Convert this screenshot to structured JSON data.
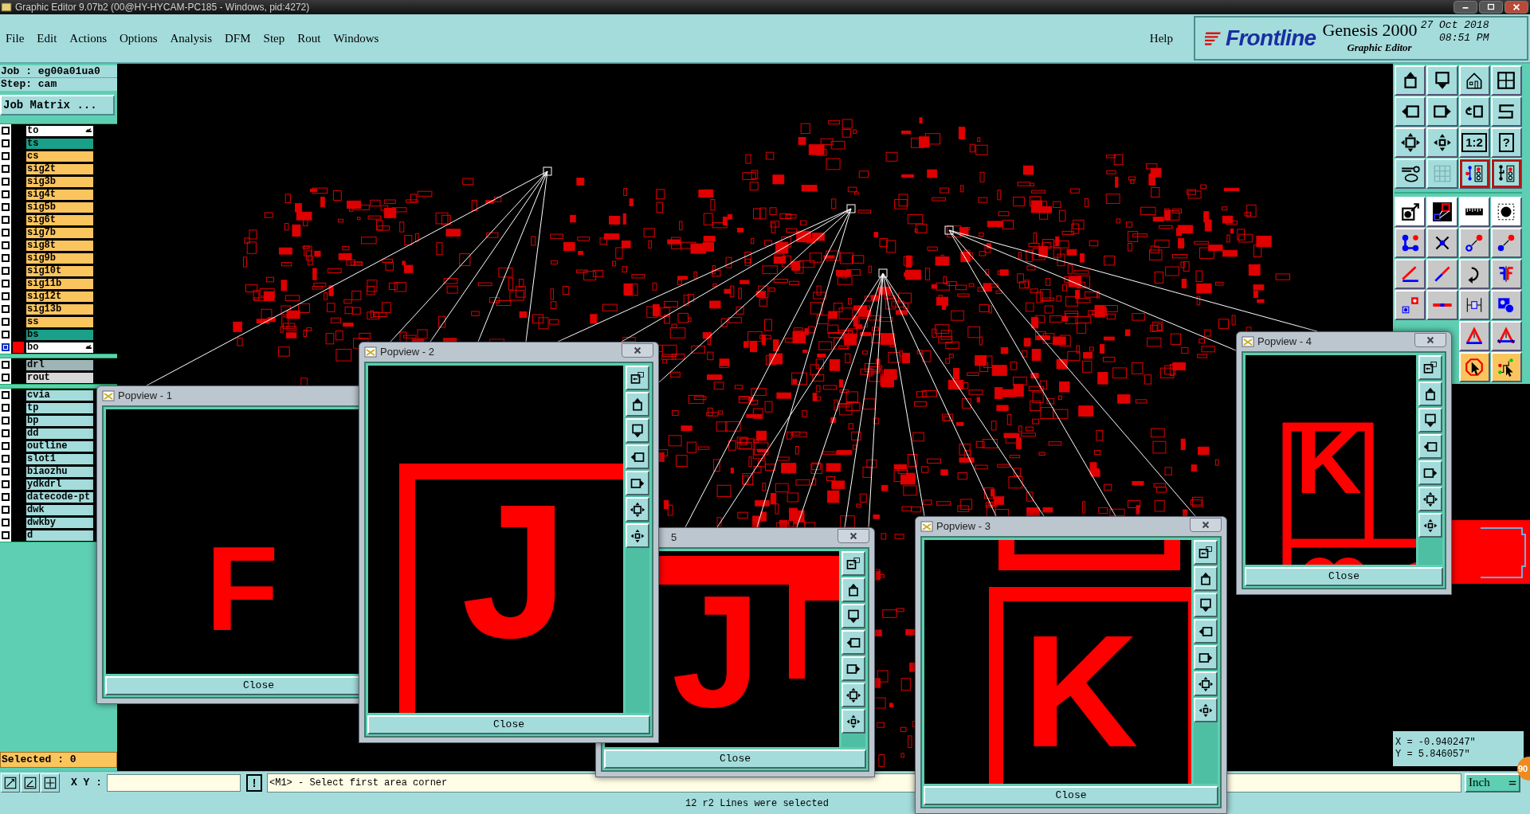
{
  "window": {
    "title": "Graphic Editor 9.07b2 (00@HY-HYCAM-PC185 - Windows, pid:4272)"
  },
  "menu": [
    {
      "label": "File"
    },
    {
      "label": "Edit"
    },
    {
      "label": "Actions"
    },
    {
      "label": "Options"
    },
    {
      "label": "Analysis"
    },
    {
      "label": "DFM"
    },
    {
      "label": "Step"
    },
    {
      "label": "Rout"
    },
    {
      "label": "Windows"
    }
  ],
  "help": "Help",
  "brand": {
    "logo": "Frontline",
    "product": "Genesis 2000",
    "subtitle": "Graphic Editor",
    "date": "27 Oct 2018",
    "time": "08:51 PM"
  },
  "job": "Job : eg00a01ua0",
  "step": "Step: cam",
  "job_matrix_button": "Job Matrix ...",
  "layer_groups": [
    {
      "layers": [
        {
          "name": "to",
          "color": "#ffffff",
          "selected": false,
          "displayed": false,
          "affected": true
        },
        {
          "name": "ts",
          "color": "#1aa088",
          "selected": false,
          "displayed": false,
          "affected": false
        },
        {
          "name": "cs",
          "color": "#fbc55e",
          "selected": false,
          "displayed": false,
          "affected": false
        },
        {
          "name": "sig2t",
          "color": "#fbc55e",
          "selected": false,
          "displayed": false,
          "affected": false
        },
        {
          "name": "sig3b",
          "color": "#fbc55e",
          "selected": false,
          "displayed": false,
          "affected": false
        },
        {
          "name": "sig4t",
          "color": "#fbc55e",
          "selected": false,
          "displayed": false,
          "affected": false
        },
        {
          "name": "sig5b",
          "color": "#fbc55e",
          "selected": false,
          "displayed": false,
          "affected": false
        },
        {
          "name": "sig6t",
          "color": "#fbc55e",
          "selected": false,
          "displayed": false,
          "affected": false
        },
        {
          "name": "sig7b",
          "color": "#fbc55e",
          "selected": false,
          "displayed": false,
          "affected": false
        },
        {
          "name": "sig8t",
          "color": "#fbc55e",
          "selected": false,
          "displayed": false,
          "affected": false
        },
        {
          "name": "sig9b",
          "color": "#fbc55e",
          "selected": false,
          "displayed": false,
          "affected": false
        },
        {
          "name": "sig10t",
          "color": "#fbc55e",
          "selected": false,
          "displayed": false,
          "affected": false
        },
        {
          "name": "sig11b",
          "color": "#fbc55e",
          "selected": false,
          "displayed": false,
          "affected": false
        },
        {
          "name": "sig12t",
          "color": "#fbc55e",
          "selected": false,
          "displayed": false,
          "affected": false
        },
        {
          "name": "sig13b",
          "color": "#fbc55e",
          "selected": false,
          "displayed": false,
          "affected": false
        },
        {
          "name": "ss",
          "color": "#fbc55e",
          "selected": false,
          "displayed": false,
          "affected": false
        },
        {
          "name": "bs",
          "color": "#1aa088",
          "selected": false,
          "displayed": false,
          "affected": false
        },
        {
          "name": "bo",
          "color": "#ffffff",
          "selected": true,
          "displayed": true,
          "affected": true
        }
      ]
    },
    {
      "layers": [
        {
          "name": "drl",
          "color": "#9fb4b7",
          "selected": false,
          "displayed": false,
          "affected": false
        },
        {
          "name": "rout",
          "color": "#d8d8d8",
          "selected": false,
          "displayed": false,
          "affected": false
        }
      ]
    },
    {
      "layers": [
        {
          "name": "cvia",
          "color": "#a4dcdc",
          "selected": false,
          "displayed": false,
          "affected": false
        },
        {
          "name": "tp",
          "color": "#a4dcdc",
          "selected": false,
          "displayed": false,
          "affected": false
        },
        {
          "name": "bp",
          "color": "#a4dcdc",
          "selected": false,
          "displayed": false,
          "affected": false
        },
        {
          "name": "dd",
          "color": "#a4dcdc",
          "selected": false,
          "displayed": false,
          "affected": false
        },
        {
          "name": "outline",
          "color": "#a4dcdc",
          "selected": false,
          "displayed": false,
          "affected": false
        },
        {
          "name": "slot1",
          "color": "#a4dcdc",
          "selected": false,
          "displayed": false,
          "affected": false
        },
        {
          "name": "biaozhu",
          "color": "#a4dcdc",
          "selected": false,
          "displayed": false,
          "affected": false
        },
        {
          "name": "ydkdrl",
          "color": "#a4dcdc",
          "selected": false,
          "displayed": false,
          "affected": false
        },
        {
          "name": "datecode-pt",
          "color": "#a4dcdc",
          "selected": false,
          "displayed": false,
          "affected": false
        },
        {
          "name": "dwk",
          "color": "#a4dcdc",
          "selected": false,
          "displayed": false,
          "affected": false
        },
        {
          "name": "dwkby",
          "color": "#a4dcdc",
          "selected": false,
          "displayed": false,
          "affected": false
        },
        {
          "name": "d",
          "color": "#a4dcdc",
          "selected": false,
          "displayed": false,
          "affected": false
        }
      ]
    }
  ],
  "selected_count": "Selected : 0",
  "toolbar": [
    {
      "kind": "view",
      "on": false
    },
    {
      "kind": "view",
      "on": false
    },
    {
      "kind": "view",
      "on": false
    },
    {
      "kind": "view",
      "on": false
    },
    {
      "kind": "view",
      "on": false
    },
    {
      "kind": "view",
      "on": false
    },
    {
      "kind": "view",
      "on": false
    },
    {
      "kind": "view",
      "on": false
    },
    {
      "kind": "view",
      "on": false
    },
    {
      "kind": "view",
      "on": false
    },
    {
      "kind": "view",
      "on": false,
      "label": "1:2"
    },
    {
      "kind": "view",
      "on": false,
      "label": "?"
    },
    {
      "kind": "view",
      "on": false
    },
    {
      "kind": "view",
      "on": false
    },
    {
      "kind": "view",
      "on": true
    },
    {
      "kind": "view",
      "on": true
    },
    {
      "kind": "mode",
      "on": false
    },
    {
      "kind": "mode",
      "on": false
    },
    {
      "kind": "mode",
      "on": false
    },
    {
      "kind": "mode",
      "on": false
    },
    {
      "kind": "edit",
      "on": false
    },
    {
      "kind": "edit",
      "on": false
    },
    {
      "kind": "edit",
      "on": false
    },
    {
      "kind": "edit",
      "on": false
    },
    {
      "kind": "edit",
      "on": false
    },
    {
      "kind": "edit",
      "on": false
    },
    {
      "kind": "edit",
      "on": false
    },
    {
      "kind": "edit",
      "on": false
    },
    {
      "kind": "edit",
      "on": false
    },
    {
      "kind": "edit",
      "on": false
    },
    {
      "kind": "edit",
      "on": false
    },
    {
      "kind": "edit",
      "on": false
    },
    {
      "kind": "edit",
      "on": false
    },
    {
      "kind": "edit",
      "on": false
    },
    {
      "kind": "select",
      "on": false
    },
    {
      "kind": "select",
      "on": false
    }
  ],
  "coordinates": [
    "X = -0.940247\"",
    "Y = 5.846057\""
  ],
  "badge": "90",
  "xy_label": "X Y :",
  "exclaim_button": "!",
  "prompt": "<M1> - Select first area corner",
  "units": "Inch",
  "status": "12 r2 Lines were selected",
  "popviews": [
    {
      "title": "Popview - 1",
      "kind": "plain",
      "glyph": "F",
      "toolbar": false,
      "close": "Close"
    },
    {
      "title": "Popview - 2",
      "kind": "corner",
      "glyph": "J",
      "toolbar": true,
      "close": "Close"
    },
    {
      "title": "5",
      "kind": "bars",
      "glyph": "J",
      "toolbar": true,
      "close": "Close"
    },
    {
      "title": "Popview - 3",
      "kind": "boxed",
      "glyph": "K",
      "toolbar": true,
      "close": "Close"
    },
    {
      "title": "Popview - 4",
      "kind": "split",
      "glyph": "K",
      "toolbar": true,
      "close": "Close"
    }
  ]
}
